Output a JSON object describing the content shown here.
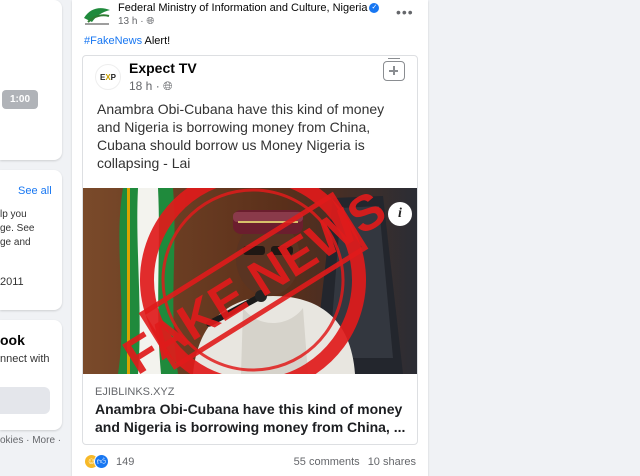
{
  "left": {
    "video_time": "1:00",
    "see_all": "See all",
    "clip_lines": [
      "lp you",
      "ge. See",
      "ge and"
    ],
    "clip_year": "2011",
    "clip_title": "ook",
    "clip_sub": "nnect with",
    "footer": "okies · More ·"
  },
  "post": {
    "page_name": "Federal Ministry of Information and Culture, Nigeria",
    "time": "13 h",
    "hashtag": "#FakeNews",
    "text_suffix": " Alert!",
    "shared": {
      "source_name": "Expect TV",
      "source_time": "18 h",
      "quote": "Anambra Obi-Cubana have this kind of money and Nigeria is borrowing money from China, Cubana should borrow us Money Nigeria is collapsing  - Lai",
      "stamp_text": "FAKE NEWS",
      "link_domain": "EJIBLINKS.XYZ",
      "link_title": "Anambra Obi-Cubana have this kind of money and Nigeria is borrowing money from China, ..."
    },
    "reaction_count": "149",
    "comments": "55 comments",
    "shares": "10 shares"
  },
  "colors": {
    "accent": "#1877f2",
    "stamp_red": "#e01b1b",
    "flag_green": "#1f8a3c"
  }
}
